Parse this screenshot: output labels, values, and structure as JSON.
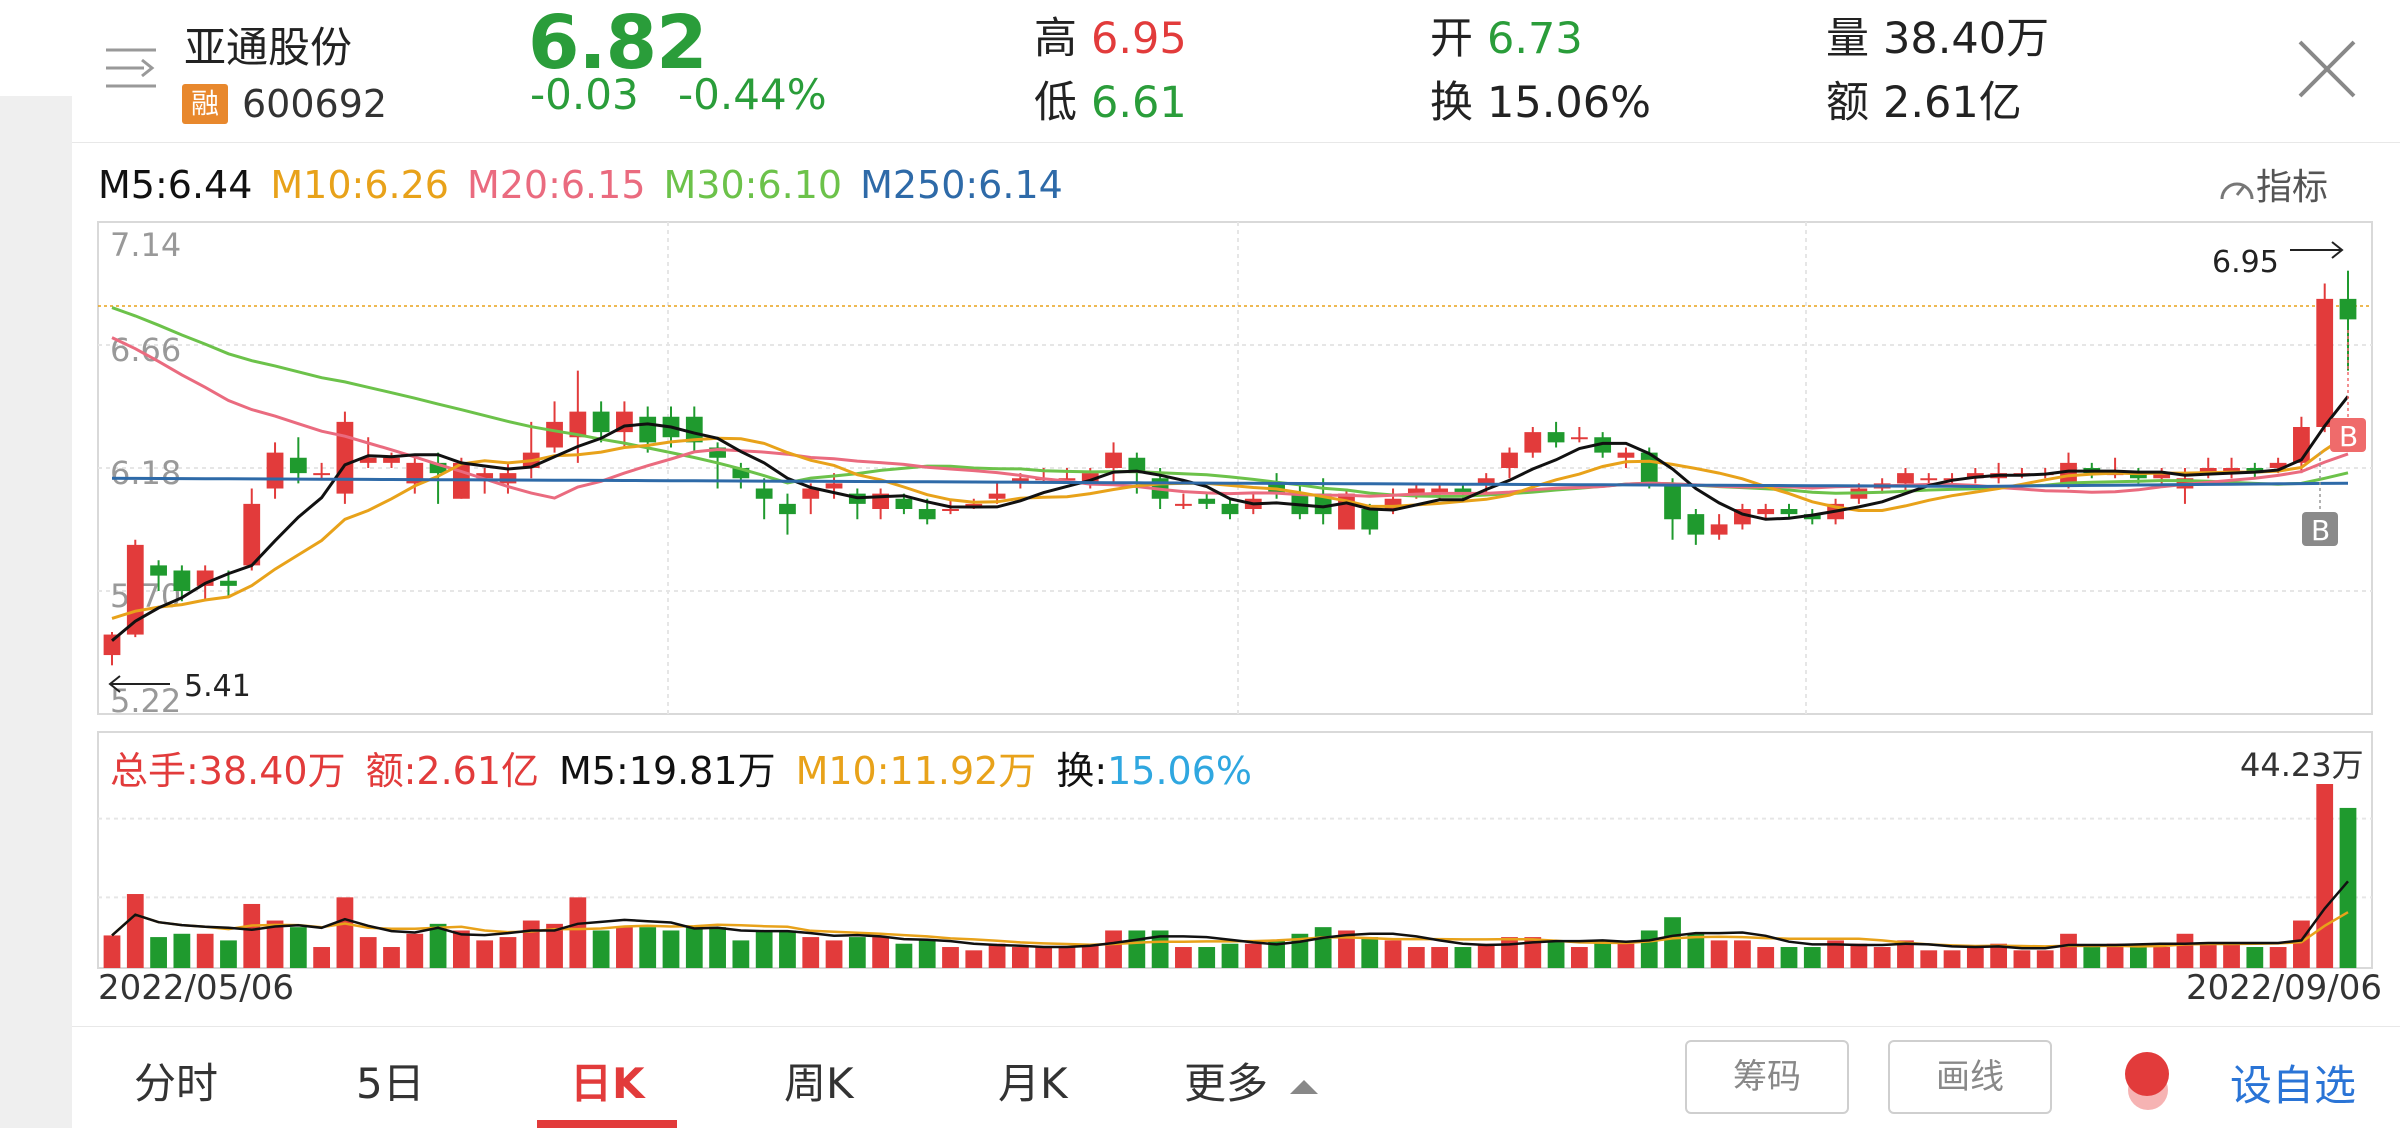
{
  "stock": {
    "name": "亚通股份",
    "margin_badge": "融",
    "code": "600692",
    "price": "6.82",
    "change": "-0.03",
    "change_pct": "-0.44%",
    "high_label": "高",
    "high": "6.95",
    "low_label": "低",
    "low": "6.61",
    "open_label": "开",
    "open": "6.73",
    "turnover_label": "换",
    "turnover": "15.06%",
    "volume_label": "量",
    "volume": "38.40万",
    "amount_label": "额",
    "amount": "2.61亿"
  },
  "ma": {
    "m5": "M5:6.44",
    "m10": "M10:6.26",
    "m20": "M20:6.15",
    "m30": "M30:6.10",
    "m250": "M250:6.14"
  },
  "indicator_label": "指标",
  "volume_panel": {
    "total": "总手:38.40万",
    "amount": "额:2.61亿",
    "m5": "M5:19.81万",
    "m10": "M10:11.92万",
    "turnover_label": "换:",
    "turnover_value": "15.06%",
    "max": "44.23万"
  },
  "dates": {
    "start": "2022/05/06",
    "end": "2022/09/06"
  },
  "tabs": [
    "分时",
    "5日",
    "日K",
    "周K",
    "月K",
    "更多"
  ],
  "active_tab": "日K",
  "buttons": {
    "chips": "筹码",
    "draw": "画线",
    "add_fav": "设自选"
  },
  "colors": {
    "up": "#e23b3b",
    "down": "#1f9a2e",
    "m5": "#111111",
    "m10": "#e8a21a",
    "m20": "#ea6b7f",
    "m30": "#6cc24a",
    "m250": "#2e6aa8",
    "accent_blue": "#2a74d6"
  },
  "chart_data": {
    "type": "candlestick",
    "x_range": [
      "2022/05/06",
      "2022/09/06"
    ],
    "y_ticks": [
      "7.14",
      "6.66",
      "6.18",
      "5.70",
      "5.22"
    ],
    "ylim": [
      5.22,
      7.14
    ],
    "max_marker": "6.95",
    "min_marker": "5.41",
    "signal_markers": [
      "B",
      "B"
    ],
    "candles": [
      [
        5.45,
        5.53,
        5.41,
        5.54
      ],
      [
        5.53,
        5.88,
        5.52,
        5.9
      ],
      [
        5.8,
        5.76,
        5.7,
        5.82
      ],
      [
        5.78,
        5.7,
        5.66,
        5.8
      ],
      [
        5.72,
        5.78,
        5.66,
        5.8
      ],
      [
        5.74,
        5.72,
        5.68,
        5.78
      ],
      [
        5.8,
        6.04,
        5.78,
        6.1
      ],
      [
        6.1,
        6.24,
        6.06,
        6.28
      ],
      [
        6.22,
        6.16,
        6.12,
        6.3
      ],
      [
        6.16,
        6.16,
        6.14,
        6.2
      ],
      [
        6.08,
        6.36,
        6.04,
        6.4
      ],
      [
        6.2,
        6.22,
        6.18,
        6.3
      ],
      [
        6.2,
        6.22,
        6.18,
        6.24
      ],
      [
        6.12,
        6.2,
        6.08,
        6.22
      ],
      [
        6.2,
        6.16,
        6.04,
        6.24
      ],
      [
        6.06,
        6.2,
        6.06,
        6.22
      ],
      [
        6.14,
        6.16,
        6.08,
        6.18
      ],
      [
        6.12,
        6.16,
        6.08,
        6.2
      ],
      [
        6.18,
        6.24,
        6.14,
        6.36
      ],
      [
        6.26,
        6.36,
        6.24,
        6.44
      ],
      [
        6.3,
        6.4,
        6.2,
        6.56
      ],
      [
        6.4,
        6.32,
        6.28,
        6.44
      ],
      [
        6.32,
        6.4,
        6.26,
        6.44
      ],
      [
        6.38,
        6.28,
        6.24,
        6.42
      ],
      [
        6.38,
        6.3,
        6.26,
        6.42
      ],
      [
        6.38,
        6.28,
        6.24,
        6.42
      ],
      [
        6.26,
        6.22,
        6.1,
        6.28
      ],
      [
        6.18,
        6.14,
        6.1,
        6.2
      ],
      [
        6.1,
        6.06,
        5.98,
        6.14
      ],
      [
        6.04,
        6.0,
        5.92,
        6.08
      ],
      [
        6.06,
        6.1,
        6.0,
        6.12
      ],
      [
        6.1,
        6.12,
        6.06,
        6.16
      ],
      [
        6.08,
        6.04,
        5.98,
        6.1
      ],
      [
        6.02,
        6.08,
        5.98,
        6.1
      ],
      [
        6.06,
        6.02,
        6.0,
        6.08
      ],
      [
        6.02,
        5.98,
        5.96,
        6.06
      ],
      [
        6.02,
        6.02,
        6.0,
        6.06
      ],
      [
        6.04,
        6.04,
        6.02,
        6.06
      ],
      [
        6.06,
        6.08,
        6.04,
        6.12
      ],
      [
        6.12,
        6.14,
        6.1,
        6.16
      ],
      [
        6.14,
        6.14,
        6.12,
        6.18
      ],
      [
        6.14,
        6.14,
        6.12,
        6.18
      ],
      [
        6.12,
        6.16,
        6.1,
        6.18
      ],
      [
        6.18,
        6.24,
        6.12,
        6.28
      ],
      [
        6.22,
        6.16,
        6.08,
        6.24
      ],
      [
        6.14,
        6.06,
        6.02,
        6.18
      ],
      [
        6.04,
        6.04,
        6.02,
        6.08
      ],
      [
        6.06,
        6.04,
        6.02,
        6.08
      ],
      [
        6.04,
        6.0,
        5.98,
        6.06
      ],
      [
        6.02,
        6.06,
        6.0,
        6.08
      ],
      [
        6.12,
        6.08,
        6.06,
        6.16
      ],
      [
        6.08,
        6.0,
        5.98,
        6.12
      ],
      [
        6.08,
        6.0,
        5.96,
        6.14
      ],
      [
        5.94,
        6.08,
        5.94,
        6.1
      ],
      [
        6.02,
        5.94,
        5.92,
        6.04
      ],
      [
        6.02,
        6.06,
        6.0,
        6.1
      ],
      [
        6.08,
        6.1,
        6.06,
        6.12
      ],
      [
        6.08,
        6.1,
        6.06,
        6.12
      ],
      [
        6.1,
        6.08,
        6.06,
        6.12
      ],
      [
        6.12,
        6.14,
        6.08,
        6.16
      ],
      [
        6.18,
        6.24,
        6.14,
        6.26
      ],
      [
        6.24,
        6.32,
        6.22,
        6.34
      ],
      [
        6.32,
        6.28,
        6.26,
        6.36
      ],
      [
        6.3,
        6.3,
        6.28,
        6.34
      ],
      [
        6.3,
        6.24,
        6.22,
        6.32
      ],
      [
        6.22,
        6.24,
        6.18,
        6.26
      ],
      [
        6.24,
        6.12,
        6.1,
        6.26
      ],
      [
        6.12,
        5.98,
        5.9,
        6.14
      ],
      [
        6.0,
        5.92,
        5.88,
        6.02
      ],
      [
        5.92,
        5.96,
        5.9,
        6.0
      ],
      [
        5.96,
        6.02,
        5.94,
        6.04
      ],
      [
        6.0,
        6.02,
        5.98,
        6.04
      ],
      [
        6.02,
        6.0,
        5.98,
        6.04
      ],
      [
        6.0,
        5.98,
        5.96,
        6.02
      ],
      [
        5.98,
        6.04,
        5.96,
        6.06
      ],
      [
        6.06,
        6.1,
        6.04,
        6.12
      ],
      [
        6.1,
        6.12,
        6.08,
        6.14
      ],
      [
        6.12,
        6.16,
        6.08,
        6.18
      ],
      [
        6.14,
        6.14,
        6.12,
        6.16
      ],
      [
        6.14,
        6.14,
        6.12,
        6.16
      ],
      [
        6.14,
        6.16,
        6.12,
        6.18
      ],
      [
        6.14,
        6.16,
        6.12,
        6.2
      ],
      [
        6.16,
        6.16,
        6.14,
        6.18
      ],
      [
        6.16,
        6.16,
        6.14,
        6.18
      ],
      [
        6.12,
        6.2,
        6.1,
        6.24
      ],
      [
        6.18,
        6.16,
        6.14,
        6.2
      ],
      [
        6.16,
        6.16,
        6.14,
        6.22
      ],
      [
        6.16,
        6.14,
        6.12,
        6.18
      ],
      [
        6.14,
        6.16,
        6.12,
        6.18
      ],
      [
        6.1,
        6.14,
        6.04,
        6.18
      ],
      [
        6.16,
        6.18,
        6.14,
        6.22
      ],
      [
        6.16,
        6.18,
        6.14,
        6.22
      ],
      [
        6.18,
        6.16,
        6.14,
        6.2
      ],
      [
        6.18,
        6.2,
        6.16,
        6.22
      ],
      [
        6.2,
        6.34,
        6.16,
        6.38
      ],
      [
        6.34,
        6.84,
        6.32,
        6.9
      ],
      [
        6.84,
        6.76,
        6.56,
        6.95
      ]
    ],
    "volume_max": "44.23万"
  }
}
